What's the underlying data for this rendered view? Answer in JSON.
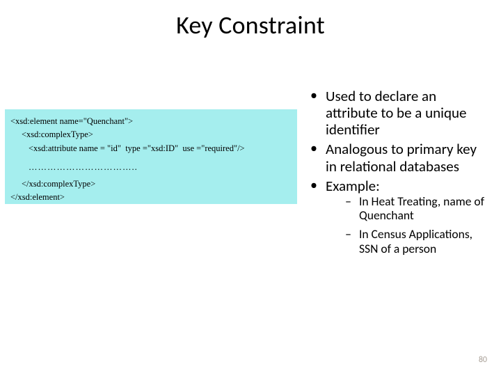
{
  "title": "Key Constraint",
  "code": {
    "line1": "<xsd:element name=\"Quenchant\">",
    "line2": "<xsd:complexType>",
    "line3": "<xsd:attribute name = \"id\"  type =\"xsd:ID\"  use =\"required\"/>",
    "dots": "……………………………..",
    "line4": "</xsd:complexType>",
    "line5": "</xsd:element>"
  },
  "bullets": {
    "b1": "Used to declare an attribute to be a unique identifier",
    "b2": "Analogous to primary key in relational databases",
    "b3": "Example:",
    "sub1": "In Heat Treating, name of Quenchant",
    "sub2": "In Census Applications, SSN of a person"
  },
  "page": "80"
}
